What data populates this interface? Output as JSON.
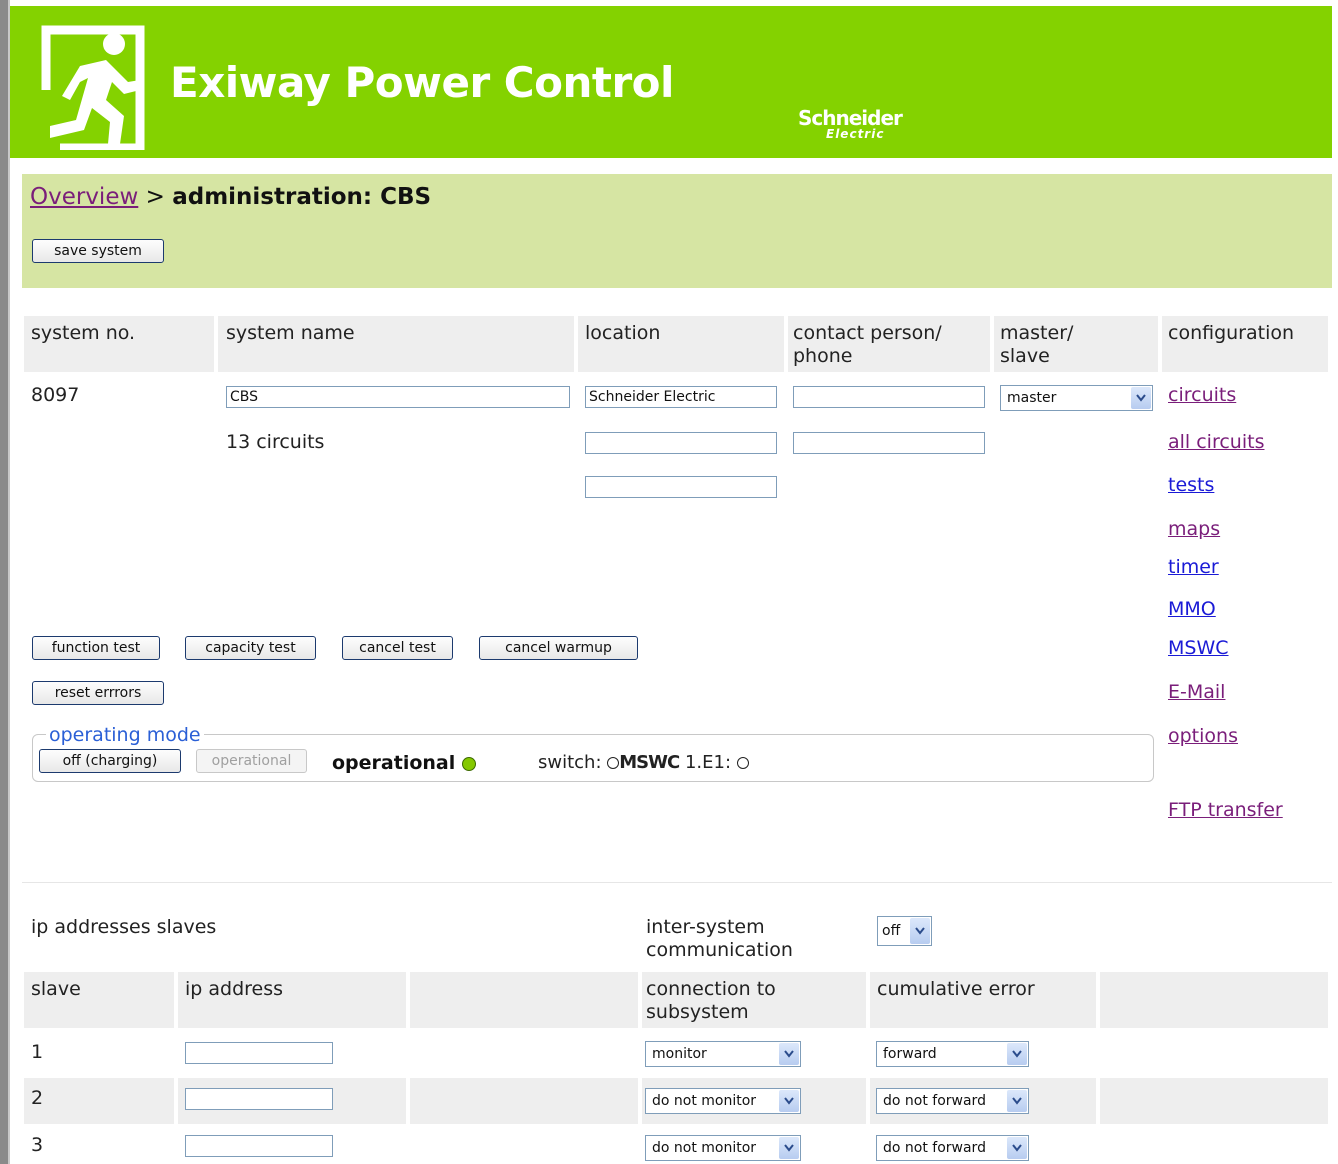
{
  "header": {
    "app_title": "Exiway Power Control",
    "brand_line1": "Schneider",
    "brand_line2": "Electric",
    "color": "#84d200"
  },
  "admin": {
    "breadcrumb_link": "Overview",
    "breadcrumb_sep": ">",
    "breadcrumb_current": "administration: CBS",
    "save_button": "save system"
  },
  "system_table": {
    "headers": {
      "system_no": "system no.",
      "system_name": "system name",
      "location": "location",
      "contact_line1": "contact person/",
      "contact_line2": "phone",
      "master_line1": "master/",
      "master_line2": "slave",
      "configuration": "configuration"
    },
    "system_no": "8097",
    "system_name": "CBS",
    "circuits_count": "13 circuits",
    "location_1": "Schneider Electric",
    "location_2": "",
    "location_3": "",
    "contact_1": "",
    "contact_2": "",
    "master_slave": "master"
  },
  "config_links": [
    "circuits",
    "all circuits",
    "tests",
    "maps",
    "timer",
    "MMO",
    "MSWC",
    "E-Mail",
    "options",
    "FTP transfer"
  ],
  "action_buttons": {
    "function_test": "function test",
    "capacity_test": "capacity test",
    "cancel_test": "cancel test",
    "cancel_warmup": "cancel warmup",
    "reset_errors": "reset errrors"
  },
  "operating_mode": {
    "legend": "operating mode",
    "off_button": "off (charging)",
    "operational_button": "operational",
    "status_label": "operational",
    "switch_label": "switch:",
    "mswc_label": "MSWC",
    "e1_label": "1.E1:"
  },
  "slaves": {
    "title": "ip addresses slaves",
    "inter_system_line1": "inter-system",
    "inter_system_line2": "communication",
    "inter_system_value": "off",
    "headers": {
      "slave": "slave",
      "ip_address": "ip address",
      "connection_line1": "connection to",
      "connection_line2": "subsystem",
      "cumulative_error": "cumulative error"
    },
    "rows": [
      {
        "slave": "1",
        "ip": "",
        "connection": "monitor",
        "cumulative": "forward"
      },
      {
        "slave": "2",
        "ip": "",
        "connection": "do not monitor",
        "cumulative": "do not forward"
      },
      {
        "slave": "3",
        "ip": "",
        "connection": "do not monitor",
        "cumulative": "do not forward"
      }
    ]
  }
}
